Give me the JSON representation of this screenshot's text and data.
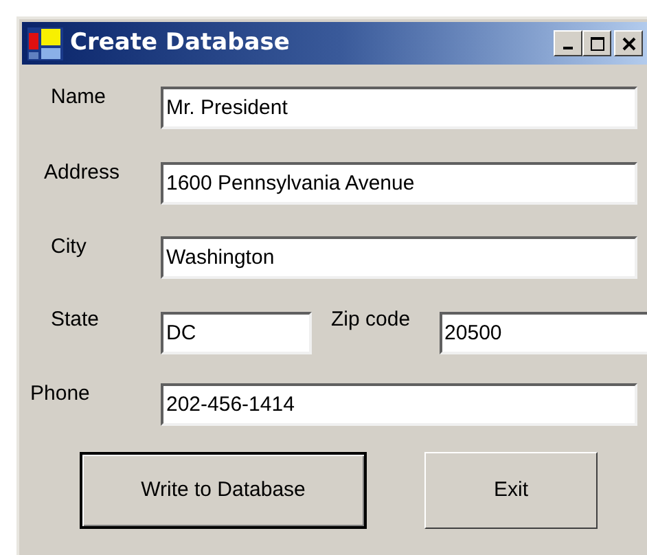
{
  "window": {
    "title": "Create Database"
  },
  "rows": [
    [
      {
        "label": "Name",
        "value": "Mr. President"
      }
    ],
    [
      {
        "label": "Address",
        "value": "1600 Pennsylvania Avenue"
      }
    ],
    [
      {
        "label": "City",
        "value": "Washington"
      }
    ],
    [
      {
        "label": "State",
        "value": "DC"
      },
      {
        "label": "Zip code",
        "value": "20500"
      }
    ],
    [
      {
        "label": "Phone",
        "value": "202-456-1414"
      }
    ]
  ],
  "buttons": [
    {
      "label": "Write to Database",
      "default": true
    },
    {
      "label": "Exit",
      "default": false
    }
  ]
}
